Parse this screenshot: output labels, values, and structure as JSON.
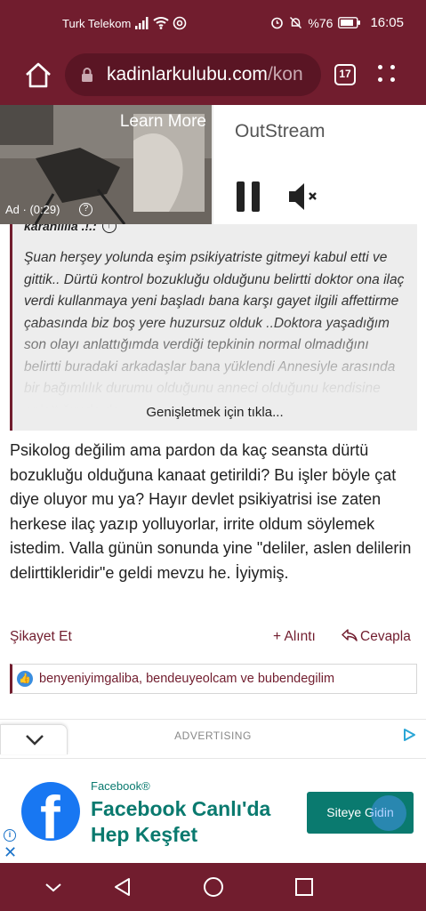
{
  "status_bar": {
    "carrier": "Turk Telekom",
    "battery": "%76",
    "time": "16:05"
  },
  "browser": {
    "url_main": "kadinlarkulubu.com",
    "url_rest": "/kon",
    "tab_count": "17"
  },
  "video_ad": {
    "learn_more": "Learn More",
    "timer": "Ad · (0:29)",
    "info_glyph": "?",
    "player_label": "OutStream"
  },
  "quote": {
    "author": "karanlilia .!.:",
    "text": "Şuan herşey yolunda eşim psikiyatriste gitmeyi kabul etti ve gittik.. Dürtü kontrol bozukluğu olduğunu belirtti doktor ona ilaç verdi kullanmaya yeni başladı bana karşı gayet ilgili affettirme çabasında biz boş yere huzursuz olduk ..Doktora yaşadığım son olayı anlattığımda verdiği tepkinin normal olmadığını belirtti buradaki arkadaşlar bana yüklendi Annesiyle arasında bir bağımlılık durumu olduğunu anneci olduğunu kendisine anlattığımda da",
    "expand_label": "Genişletmek için tıkla..."
  },
  "post": {
    "text": "Psikolog değilim ama pardon da kaç seansta dürtü bozukluğu olduğuna kanaat getirildi? Bu işler böyle çat diye oluyor mu ya? Hayır devlet psikiyatrisi ise zaten herkese ilaç yazıp yolluyorlar, irrite oldum söylemek istedim. Valla günün sonunda yine \"deliler, aslen delilerin delirttikleridir\"e geldi mevzu he. İyiymiş.",
    "report_label": "Şikayet Et",
    "quote_label": "Alıntı",
    "reply_label": "Cevapla",
    "likes": "benyeniyimgaliba, bendeuyeolcam ve bubendegilim"
  },
  "advertising_label": "ADVERTISING",
  "banner_ad": {
    "sponsor": "Facebook®",
    "headline": "Facebook Canlı'da Hep Keşfet",
    "cta": "Siteye Gidin",
    "logo_letter": "f",
    "info_glyph": "i",
    "close_glyph": "✕"
  },
  "colors": {
    "brand": "#711d2e",
    "ad_accent": "#0a7a6f",
    "facebook_blue": "#1877f2"
  },
  "icons": [
    "home-icon",
    "lock-icon",
    "tabs-icon",
    "overflow-menu-icon",
    "pause-icon",
    "mute-icon",
    "like-icon",
    "adchoices-icon",
    "back-icon",
    "home-circle-icon",
    "recents-icon"
  ]
}
